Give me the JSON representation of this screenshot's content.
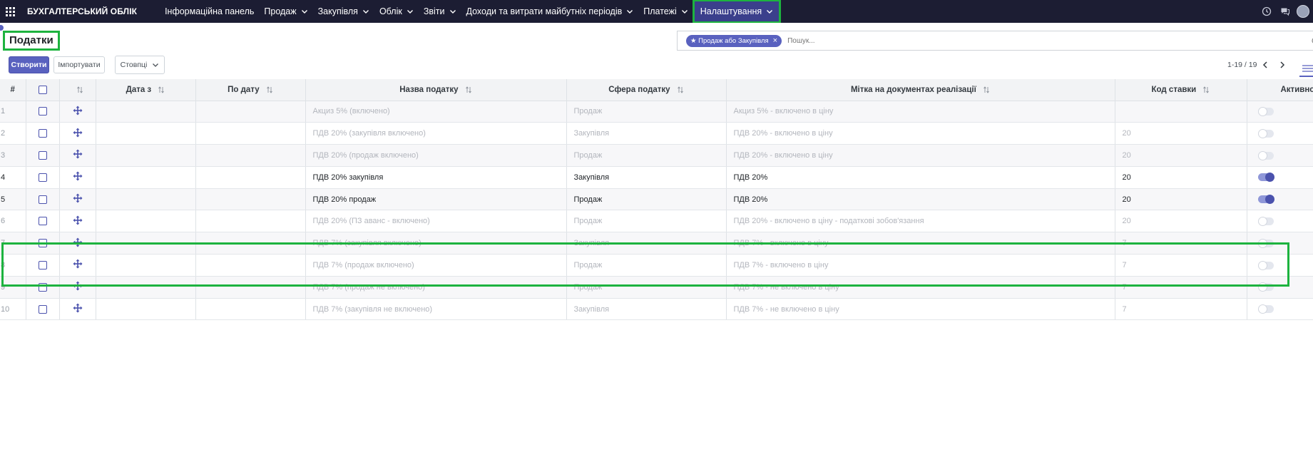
{
  "app": {
    "brand": "БУХГАЛТЕРСЬКИЙ ОБЛІК"
  },
  "nav": {
    "items": [
      {
        "label": "Інформаційна панель",
        "dropdown": false
      },
      {
        "label": "Продаж",
        "dropdown": true
      },
      {
        "label": "Закупівля",
        "dropdown": true
      },
      {
        "label": "Облік",
        "dropdown": true
      },
      {
        "label": "Звіти",
        "dropdown": true
      },
      {
        "label": "Доходи та витрати майбутніх періодів",
        "dropdown": true
      },
      {
        "label": "Платежі",
        "dropdown": true
      },
      {
        "label": "Налаштування",
        "dropdown": true,
        "active": true
      }
    ]
  },
  "page": {
    "title": "Податки"
  },
  "search": {
    "facet": "Продаж або Закупівля",
    "placeholder": "Пошук..."
  },
  "toolbar": {
    "create": "Створити",
    "import": "Імпортувати",
    "columns": "Стовпці"
  },
  "pager": {
    "value": "1-19 / 19"
  },
  "table": {
    "headers": {
      "num": "#",
      "date_from": "Дата з",
      "date_to": "По дату",
      "name": "Назва податку",
      "scope": "Сфера податку",
      "label": "Мітка на документах реалізації",
      "code": "Код ставки",
      "active": "Активно"
    },
    "rows": [
      {
        "num": "1",
        "name": "Акциз 5% (включено)",
        "scope": "Продаж",
        "label": "Акциз 5% - включено в ціну",
        "code": "",
        "active": false
      },
      {
        "num": "2",
        "name": "ПДВ 20% (закупівля включено)",
        "scope": "Закупівля",
        "label": "ПДВ 20% - включено в ціну",
        "code": "20",
        "active": false
      },
      {
        "num": "3",
        "name": "ПДВ 20% (продаж включено)",
        "scope": "Продаж",
        "label": "ПДВ 20% - включено в ціну",
        "code": "20",
        "active": false
      },
      {
        "num": "4",
        "name": "ПДВ 20% закупівля",
        "scope": "Закупівля",
        "label": "ПДВ 20%",
        "code": "20",
        "active": true
      },
      {
        "num": "5",
        "name": "ПДВ 20% продаж",
        "scope": "Продаж",
        "label": "ПДВ 20%",
        "code": "20",
        "active": true
      },
      {
        "num": "6",
        "name": "ПДВ 20% (ПЗ аванс - включено)",
        "scope": "Продаж",
        "label": "ПДВ 20% - включено в ціну - податкові зобов'язання",
        "code": "20",
        "active": false
      },
      {
        "num": "7",
        "name": "ПДВ 7% (закупівля включено)",
        "scope": "Закупівля",
        "label": "ПДВ 7% - включено в ціну",
        "code": "7",
        "active": false
      },
      {
        "num": "8",
        "name": "ПДВ 7% (продаж включено)",
        "scope": "Продаж",
        "label": "ПДВ 7% - включено в ціну",
        "code": "7",
        "active": false
      },
      {
        "num": "9",
        "name": "ПДВ 7% (продаж не включено)",
        "scope": "Продаж",
        "label": "ПДВ 7% - не включено в ціну",
        "code": "7",
        "active": false
      },
      {
        "num": "10",
        "name": "ПДВ 7% (закупівля не включено)",
        "scope": "Закупівля",
        "label": "ПДВ 7% - не включено в ціну",
        "code": "7",
        "active": false
      }
    ]
  },
  "colors": {
    "navbar": "#1c1d33",
    "accent": "#5961bf",
    "highlight": "#1db33f"
  },
  "icons": [
    "apps-grid-icon",
    "chevron-down-icon",
    "clock-icon",
    "chat-icon",
    "sort-icon",
    "drag-handle-icon",
    "clear-icon",
    "chevron-left-icon",
    "chevron-right-icon",
    "list-view-icon"
  ]
}
